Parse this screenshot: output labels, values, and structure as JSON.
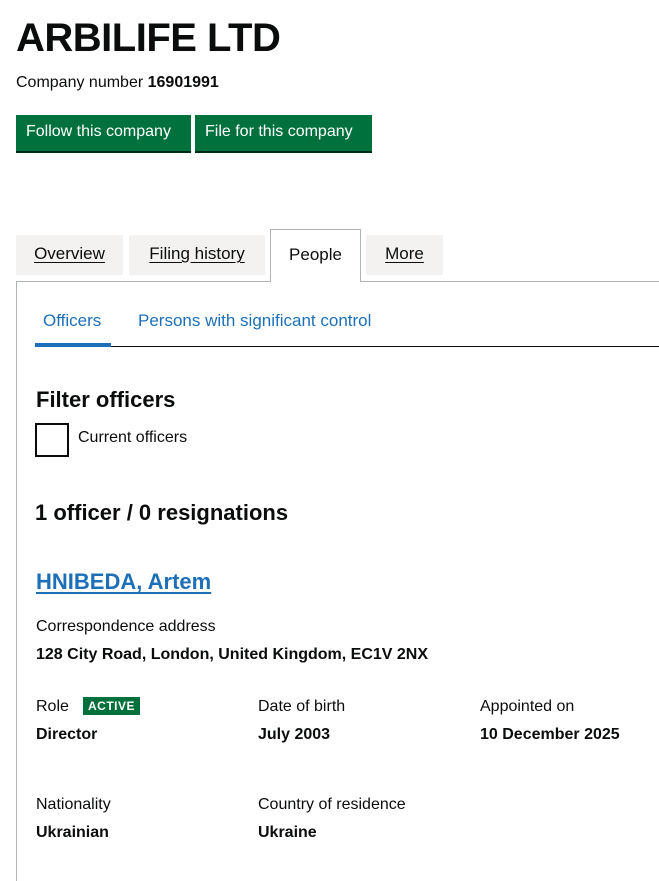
{
  "company": {
    "name": "ARBILIFE LTD",
    "number_label": "Company number",
    "number": "16901991"
  },
  "actions": {
    "follow": "Follow this company",
    "file": "File for this company"
  },
  "tabs": [
    {
      "label": "Overview"
    },
    {
      "label": "Filing history"
    },
    {
      "label": "People"
    },
    {
      "label": "More"
    }
  ],
  "subtabs": [
    {
      "label": "Officers"
    },
    {
      "label": "Persons with significant control"
    }
  ],
  "filter": {
    "heading": "Filter officers",
    "checkbox_label": "Current officers"
  },
  "summary": "1 officer / 0 resignations",
  "officer": {
    "name": "HNIBEDA, Artem",
    "address_label": "Correspondence address",
    "address": "128 City Road, London, United Kingdom, EC1V 2NX",
    "role_label": "Role",
    "status": "ACTIVE",
    "role": "Director",
    "dob_label": "Date of birth",
    "dob": "July 2003",
    "appointed_label": "Appointed on",
    "appointed": "10 December 2025",
    "nationality_label": "Nationality",
    "nationality": "Ukrainian",
    "residence_label": "Country of residence",
    "residence": "Ukraine"
  }
}
